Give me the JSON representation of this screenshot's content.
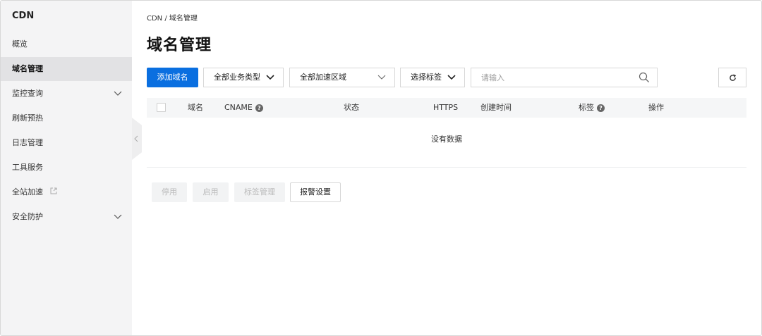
{
  "sidebar": {
    "title": "CDN",
    "items": [
      {
        "label": "概览"
      },
      {
        "label": "域名管理"
      },
      {
        "label": "监控查询"
      },
      {
        "label": "刷新预热"
      },
      {
        "label": "日志管理"
      },
      {
        "label": "工具服务"
      },
      {
        "label": "全站加速"
      },
      {
        "label": "安全防护"
      }
    ]
  },
  "breadcrumb": "CDN  /  域名管理",
  "page_title": "域名管理",
  "toolbar": {
    "add_label": "添加域名",
    "business_type": "全部业务类型",
    "region": "全部加速区域",
    "tag_select": "选择标签",
    "search_placeholder": "请输入"
  },
  "table": {
    "columns": [
      "域名",
      "CNAME",
      "状态",
      "HTTPS",
      "创建时间",
      "标签",
      "操作"
    ],
    "empty_text": "没有数据"
  },
  "actions": {
    "disable": "停用",
    "enable": "启用",
    "tag_manage": "标签管理",
    "alarm": "报警设置"
  },
  "colors": {
    "primary": "#0a6fe0",
    "sidebar_bg": "#f4f4f5",
    "active_item_bg": "#e2e2e4"
  }
}
